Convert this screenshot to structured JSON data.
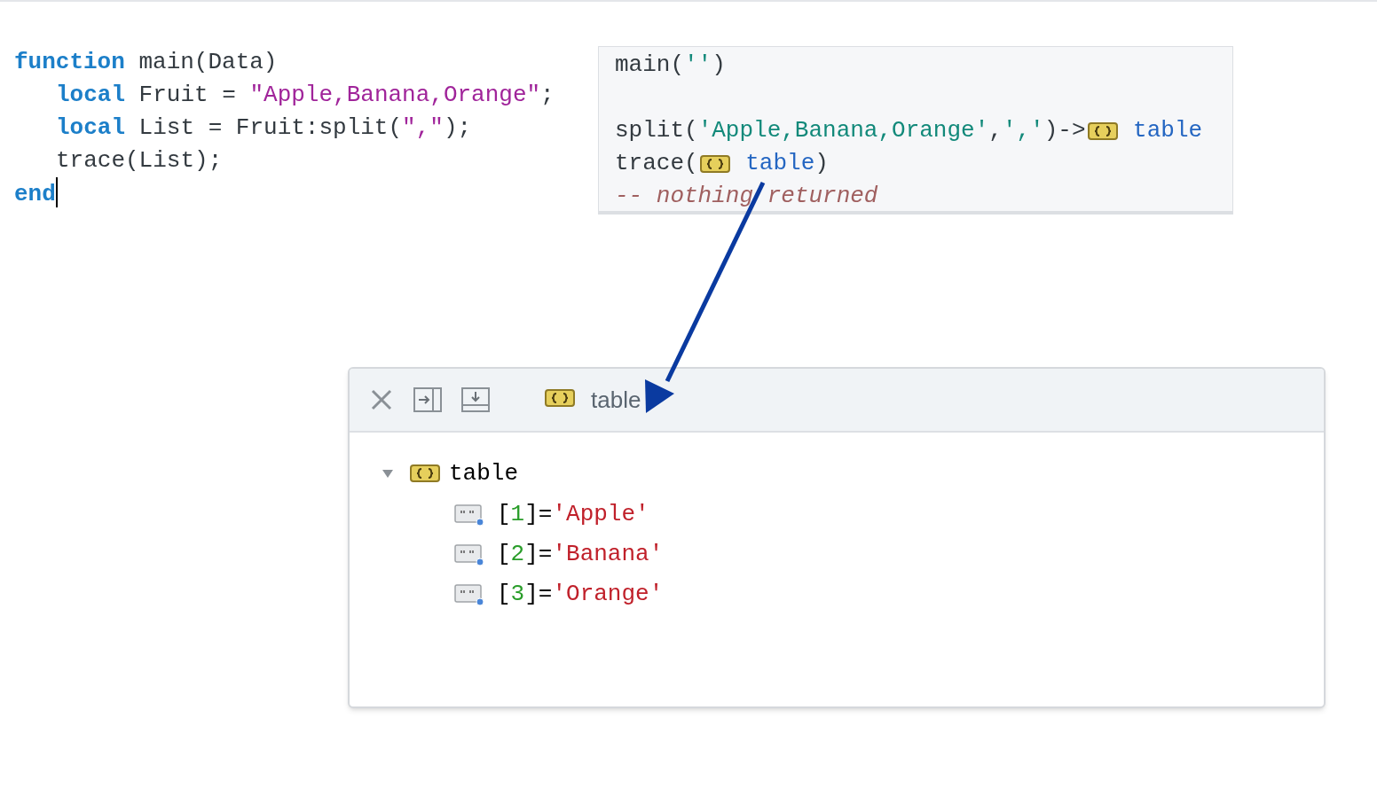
{
  "editor": {
    "lines": [
      {
        "cursor": false,
        "tokens": [
          {
            "kind": "keyword",
            "text": "function"
          },
          {
            "kind": "plain",
            "text": " main(Data)"
          }
        ],
        "children": [
          {
            "cursor": false,
            "tokens": [
              {
                "kind": "keyword",
                "text": "local"
              },
              {
                "kind": "plain",
                "text": " Fruit = "
              },
              {
                "kind": "string",
                "text": "\"Apple,Banana,Orange\""
              },
              {
                "kind": "plain",
                "text": ";"
              }
            ]
          },
          {
            "cursor": false,
            "tokens": [
              {
                "kind": "keyword",
                "text": "local"
              },
              {
                "kind": "plain",
                "text": " List = Fruit:split("
              },
              {
                "kind": "string",
                "text": "\",\""
              },
              {
                "kind": "plain",
                "text": ");"
              }
            ]
          },
          {
            "cursor": false,
            "tokens": [
              {
                "kind": "plain",
                "text": "trace(List);"
              }
            ]
          }
        ]
      },
      {
        "cursor": true,
        "tokens": [
          {
            "kind": "keyword",
            "text": "end"
          }
        ]
      }
    ]
  },
  "annotation": {
    "call": [
      {
        "kind": "plain",
        "text": "main("
      },
      {
        "kind": "string",
        "text": "''"
      },
      {
        "kind": "plain",
        "text": ")"
      }
    ],
    "lines": [
      [
        {
          "kind": "plain",
          "text": "split("
        },
        {
          "kind": "string",
          "text": "'Apple,Banana,Orange'"
        },
        {
          "kind": "plain",
          "text": ","
        },
        {
          "kind": "string",
          "text": "','"
        },
        {
          "kind": "plain",
          "text": ")->"
        },
        {
          "kind": "table_icon"
        },
        {
          "kind": "link",
          "text": " table"
        }
      ],
      [
        {
          "kind": "plain",
          "text": "trace("
        },
        {
          "kind": "table_icon"
        },
        {
          "kind": "link",
          "text": " table"
        },
        {
          "kind": "plain",
          "text": ")"
        }
      ],
      [
        {
          "kind": "comment",
          "text": "-- nothing returned"
        }
      ]
    ]
  },
  "inspector": {
    "title": "table",
    "tree": {
      "label": "table",
      "expanded": true,
      "children": [
        {
          "tokens": [
            {
              "kind": "punct",
              "text": "["
            },
            {
              "kind": "number",
              "text": "1"
            },
            {
              "kind": "punct",
              "text": "]="
            },
            {
              "kind": "value",
              "text": "'Apple'"
            }
          ]
        },
        {
          "tokens": [
            {
              "kind": "punct",
              "text": "["
            },
            {
              "kind": "number",
              "text": "2"
            },
            {
              "kind": "punct",
              "text": "]="
            },
            {
              "kind": "value",
              "text": "'Banana'"
            }
          ]
        },
        {
          "tokens": [
            {
              "kind": "punct",
              "text": "["
            },
            {
              "kind": "number",
              "text": "3"
            },
            {
              "kind": "punct",
              "text": "]="
            },
            {
              "kind": "value",
              "text": "'Orange'"
            }
          ]
        }
      ]
    }
  }
}
